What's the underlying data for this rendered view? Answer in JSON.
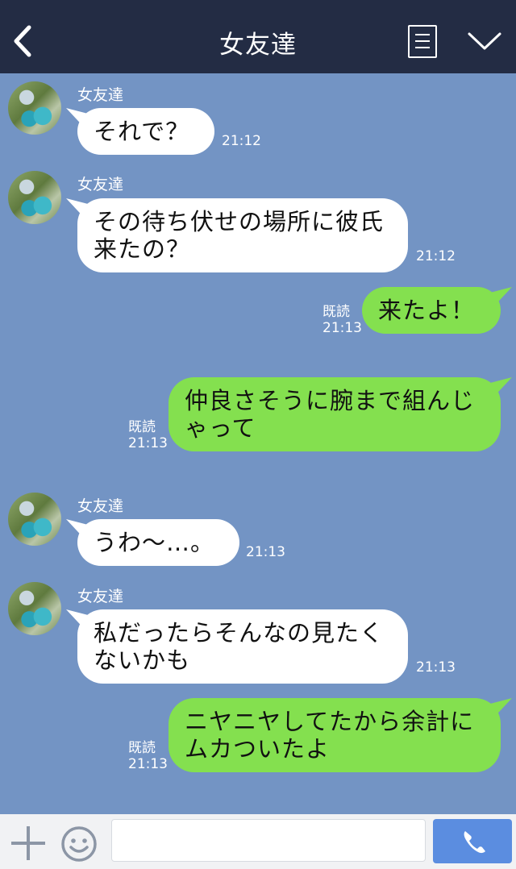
{
  "header": {
    "title": "女友達",
    "colors": {
      "bar": "#232c44",
      "chat_background": "#7394c4"
    }
  },
  "messages": [
    {
      "side": "in",
      "sender": "女友達",
      "lines": [
        "それで？"
      ],
      "time": "21:12"
    },
    {
      "side": "in",
      "sender": "女友達",
      "lines": [
        "その待ち伏せの場所に彼氏",
        "来たの？"
      ],
      "time": "21:12"
    },
    {
      "side": "out",
      "lines": [
        "来たよ！"
      ],
      "read": "既読",
      "time": "21:13"
    },
    {
      "side": "out",
      "lines": [
        "仲良さそうに腕まで組んじ",
        "ゃって"
      ],
      "read": "既読",
      "time": "21:13"
    },
    {
      "side": "in",
      "sender": "女友達",
      "lines": [
        "うわ〜…。"
      ],
      "time": "21:13"
    },
    {
      "side": "in",
      "sender": "女友達",
      "lines": [
        "私だったらそんなの見たく",
        "ないかも"
      ],
      "time": "21:13"
    },
    {
      "side": "out",
      "lines": [
        "ニヤニヤしてたから余計に",
        "ムカついたよ"
      ],
      "read": "既読",
      "time": "21:13"
    }
  ],
  "bubble_colors": {
    "incoming": "#ffffff",
    "outgoing": "#84e04f"
  },
  "input": {
    "value": "",
    "placeholder": ""
  },
  "icons": {
    "back": "chevron-left-icon",
    "menu": "menu-icon",
    "collapse": "chevron-down-icon",
    "plus": "plus-icon",
    "emoji": "smiley-icon",
    "call": "phone-icon"
  }
}
